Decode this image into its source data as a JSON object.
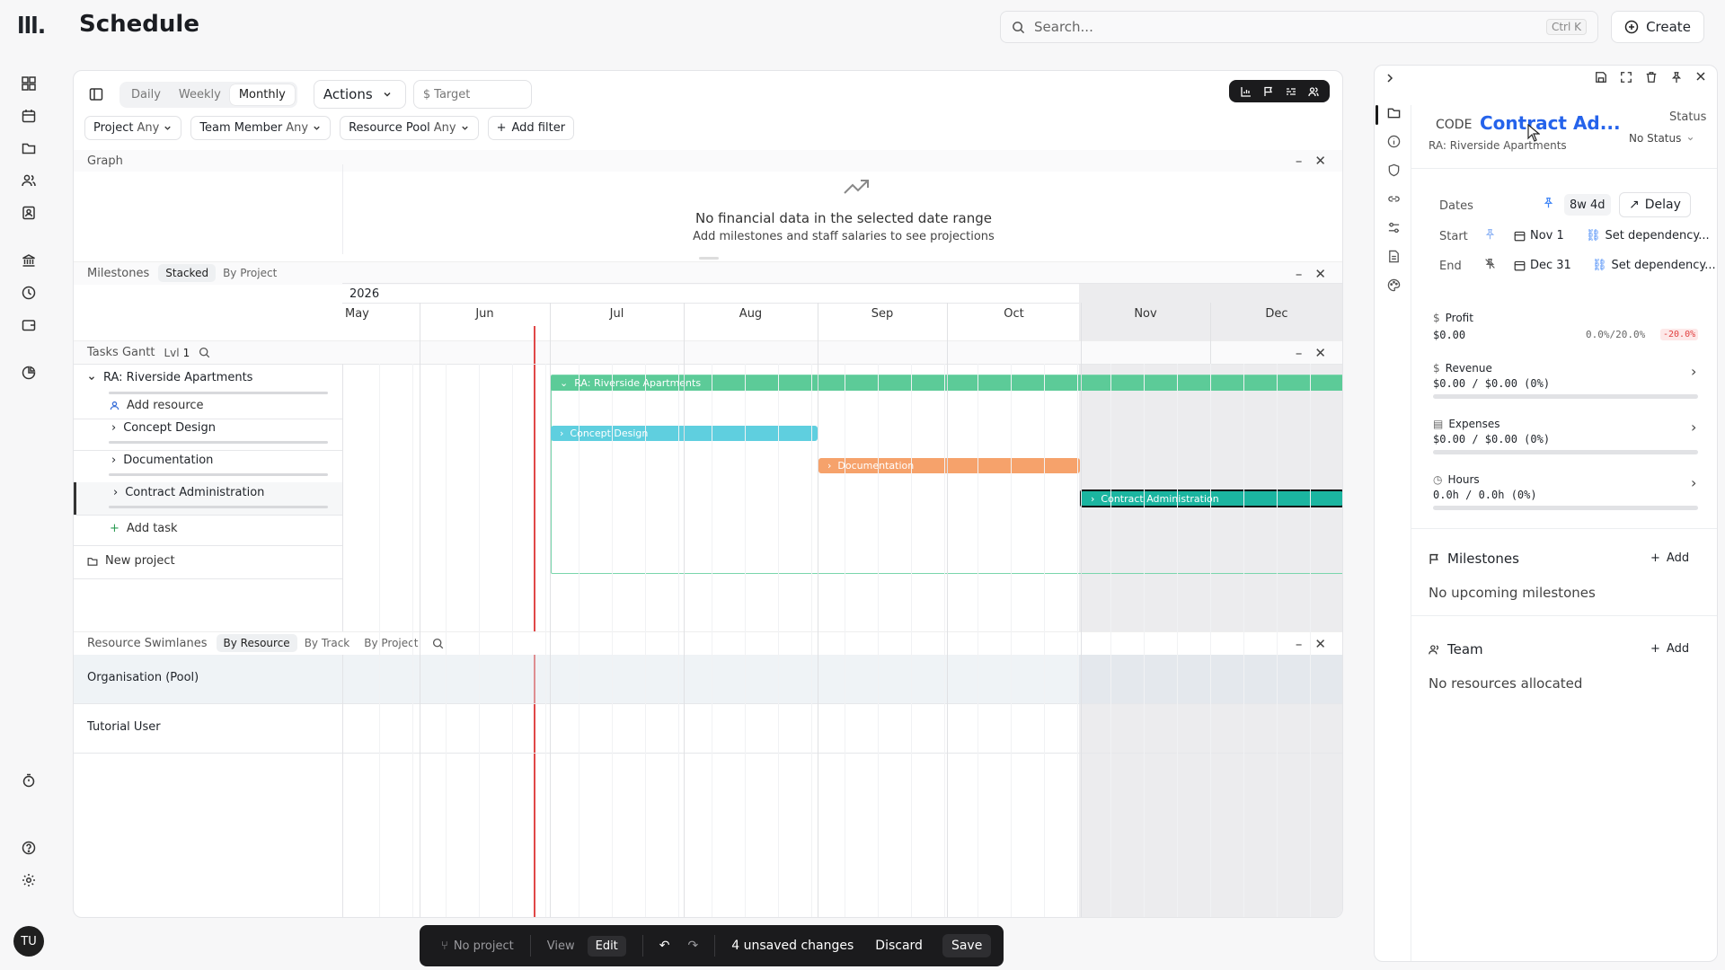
{
  "app": {
    "title": "Schedule",
    "logo": "lll."
  },
  "search": {
    "placeholder": "Search...",
    "shortcut": "Ctrl K"
  },
  "create": {
    "label": "Create"
  },
  "toolbar": {
    "views": [
      "Daily",
      "Weekly",
      "Monthly"
    ],
    "active_view": "Monthly",
    "actions": "Actions",
    "target": "Target"
  },
  "filters": [
    {
      "name": "Project",
      "value": "Any"
    },
    {
      "name": "Team Member",
      "value": "Any"
    },
    {
      "name": "Resource Pool",
      "value": "Any"
    }
  ],
  "add_filter": "Add filter",
  "graph": {
    "title": "Graph",
    "empty": "No financial data in the selected date range",
    "hint": "Add milestones and staff salaries to see projections"
  },
  "milestones": {
    "title": "Milestones",
    "tabs": [
      "Stacked",
      "By Project"
    ]
  },
  "timeline": {
    "year": "2026",
    "months": [
      "May",
      "Jun",
      "Jul",
      "Aug",
      "Sep",
      "Oct",
      "Nov",
      "Dec"
    ]
  },
  "gantt": {
    "title": "Tasks Gantt",
    "level_label": "Lvl",
    "level": "1",
    "project": "RA: Riverside Apartments",
    "add_resource": "Add resource",
    "tasks": [
      "Concept Design",
      "Documentation",
      "Contract Administration"
    ],
    "add_task": "Add task",
    "new_project": "New project",
    "bars": {
      "project": "RA: Riverside Apartments",
      "concept": "Concept Design",
      "documentation": "Documentation",
      "contract": "Contract Administration"
    },
    "colors": {
      "project": "#5ccb98",
      "concept": "#5fcfdf",
      "documentation": "#f6a26b",
      "contract": "#1bb5a0"
    }
  },
  "swimlanes": {
    "title": "Resource Swimlanes",
    "tabs": [
      "By Resource",
      "By Track",
      "By Project"
    ],
    "rows": [
      "Organisation (Pool)",
      "Tutorial User"
    ]
  },
  "bottom": {
    "project": "No project",
    "view": "View",
    "edit": "Edit",
    "changes": "4 unsaved changes",
    "discard": "Discard",
    "save": "Save"
  },
  "panel": {
    "code": "CODE",
    "name": "Contract Ad...",
    "subtitle": "RA: Riverside Apartments",
    "status_label": "Status",
    "status": "No Status",
    "dates_label": "Dates",
    "duration": "8w 4d",
    "delay": "Delay",
    "start_label": "Start",
    "start": "Nov 1",
    "end_label": "End",
    "end": "Dec 31",
    "set_dependency": "Set dependency...",
    "profit": {
      "label": "Profit",
      "value": "$0.00",
      "ratio": "0.0%/20.0%",
      "delta": "-20.0%"
    },
    "revenue": {
      "label": "Revenue",
      "value": "$0.00 / $0.00 (0%)"
    },
    "expenses": {
      "label": "Expenses",
      "value": "$0.00 / $0.00 (0%)"
    },
    "hours": {
      "label": "Hours",
      "value": "0.0h / 0.0h (0%)"
    },
    "milestones": {
      "title": "Milestones",
      "add": "Add",
      "empty": "No upcoming milestones"
    },
    "team": {
      "title": "Team",
      "add": "Add",
      "empty": "No resources allocated"
    }
  },
  "user": {
    "initials": "TU"
  }
}
